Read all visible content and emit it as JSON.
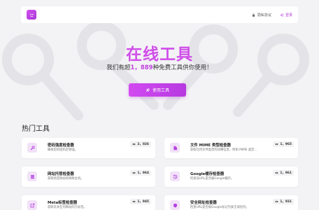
{
  "nav": {
    "privacy_label": "隐私协议",
    "login_label": "登录"
  },
  "hero": {
    "title": "在线工具",
    "subtitle_prefix": "我们有超",
    "subtitle_count": "1，889",
    "subtitle_suffix": "种免费工具供你使用！",
    "cta_label": "使用工具"
  },
  "section": {
    "title": "热门工具"
  },
  "tools": [
    {
      "title": "密码强度检查器",
      "desc": "确保您的密码足够强。",
      "views": "2，026",
      "icon": "key-icon"
    },
    {
      "title": "文件 MIME 类型检查器",
      "desc": "获取任何文件类型的详细信息，例如 MIME 类型…",
      "views": "1，965",
      "icon": "file-icon"
    },
    {
      "title": "网站托管检查器",
      "desc": "获取给定网站的网络主机。",
      "views": "1，964",
      "icon": "server-icon"
    },
    {
      "title": "Google缓存检查器",
      "desc": "检查该URL是否被Google缓存。",
      "views": "1，961",
      "icon": "history-icon"
    },
    {
      "title": "Meta标签检查器",
      "desc": "获取有关任何网站的元标签。",
      "views": "1，945",
      "icon": "external-link-icon"
    },
    {
      "title": "安全网址检查器",
      "desc": "检查URL是否被Google标记为安全或危险。",
      "views": "1，931",
      "icon": "shield-icon"
    }
  ],
  "colors": {
    "accent": "#d04ee9",
    "accent_dark": "#b63ae0",
    "background": "#f3f3f5"
  }
}
